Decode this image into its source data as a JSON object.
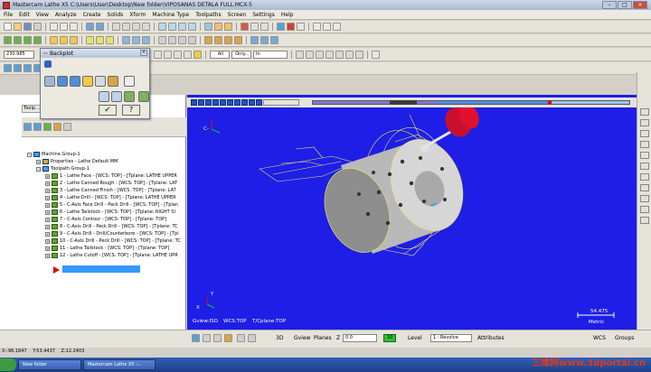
{
  "window": {
    "title": "Mastercam Lathe X5  C:\\Users\\User\\Desktop\\New folder\\VIPOSANAS DETALA FULL.MCX-5"
  },
  "menu": [
    "File",
    "Edit",
    "View",
    "Analyze",
    "Create",
    "Solids",
    "Xform",
    "Machine Type",
    "Toolpaths",
    "Screen",
    "Settings",
    "Help"
  ],
  "toolbar": {
    "field_value": "230.985",
    "all_label": "All",
    "only_label": "Only...",
    "in_label": "In"
  },
  "backplot": {
    "title": "Backplot"
  },
  "left_panel": {
    "tab_label": "Toolp..."
  },
  "tree": {
    "machine_group": "Machine Group-1",
    "properties": "Properties - Lathe Default MM",
    "toolpath_group": "Toolpath Group-1",
    "operations": [
      "1 - Lathe Face - [WCS: TOP] - [Tplane: LATHE UPPER",
      "2 - Lathe Canned Rough - [WCS: TOP] - [Tplane: LAT",
      "3 - Lathe Canned Finish - [WCS: TOP] - [Tplane: LAT",
      "4 - Lathe Drill - [WCS: TOP] - [Tplane: LATHE UPPER",
      "5 - C-Axis Face Drill - Peck Drill - [WCS: TOP] - [Tplan",
      "6 - Lathe Tailstock - [WCS: TOP] - [Tplane: RIGHT SI",
      "7 - C-Axis Contour - [WCS: TOP] - [Tplane: TOP]",
      "8 - C-Axis Drill - Peck Drill - [WCS: TOP] - [Tplane: TC",
      "9 - C-Axis Drill - Drill/Counterbore - [WCS: TOP] - [Tpl",
      "10 - C-Axis Drill - Peck Drill - [WCS: TOP] - [Tplane: TC",
      "11 - Lathe Tailstock - [WCS: TOP] - [Tplane: TOP]",
      "12 - Lathe Cutoff - [WCS: TOP] - [Tplane: LATHE UPR"
    ]
  },
  "viewport": {
    "gview": "Gview:ISO",
    "wcs": "WCS:TOP",
    "tcplane": "T/Cplane:TOP",
    "scale_value": "54.475",
    "scale_unit": "Metric",
    "axis_c": "C-",
    "axis_x": "X",
    "axis_y": "Y"
  },
  "statusbar": {
    "mode": "3D",
    "gview": "Gview",
    "planes": "Planes",
    "z_label": "Z",
    "z_value": "0.0",
    "level_value": "10",
    "level_label": "Level",
    "level_name": "1 : Revolve",
    "attributes": "Attributes",
    "wcs": "WCS",
    "groups": "Groups"
  },
  "coords": {
    "x": "X:-96.1847",
    "y": "Y:53.4437",
    "z": "Z:12.2403"
  },
  "taskbar": {
    "item1": "New folder",
    "item2": "Mastercam Lathe X5 -..."
  },
  "watermark": "三维网www.3dportal.cn",
  "colors": {
    "viewport_bg": "#1e1ee6",
    "part": "#c8c8c8",
    "tool_red": "#d01010",
    "wire": "#e3e36a"
  }
}
